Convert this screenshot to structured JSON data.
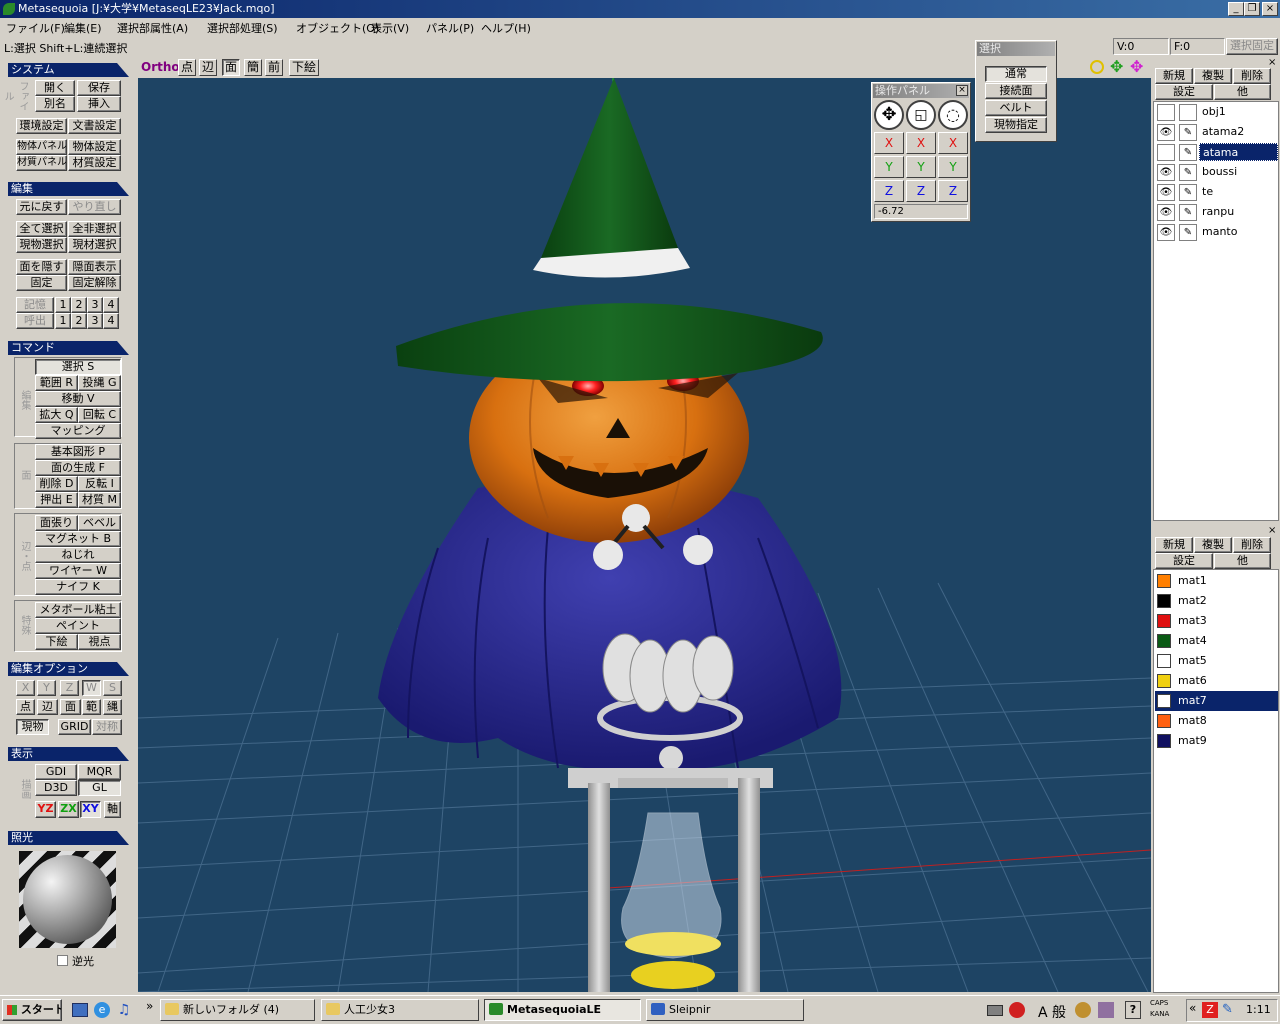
{
  "window": {
    "title": "Metasequoia [J:¥大学¥MetaseqLE23¥Jack.mqo]"
  },
  "menus": [
    "ファイル(F)",
    "編集(E)",
    "選択部属性(A)",
    "選択部処理(S)",
    "オブジェクト(O)",
    "表示(V)",
    "パネル(P)",
    "ヘルプ(H)"
  ],
  "status": {
    "hint": "L:選択  Shift+L:連続選択",
    "v": "V:0",
    "f": "F:0",
    "lock": "選択固定"
  },
  "sections": {
    "system": "システム",
    "edit": "編集",
    "command": "コマンド",
    "edit_option": "編集オプション",
    "display": "表示",
    "lighting": "照光"
  },
  "vlabels": {
    "file": "ファイル",
    "edit": "編集",
    "face": "面",
    "edge": "辺・点",
    "special": "特殊",
    "render": "描画"
  },
  "system": {
    "open": "開く",
    "save": "保存",
    "rename": "別名",
    "insert": "挿入",
    "env": "環境設定",
    "doc": "文書設定",
    "objpanel": "物体パネル",
    "objsettings": "物体設定",
    "matpanel": "材質パネル",
    "matsettings": "材質設定"
  },
  "edit": {
    "undo": "元に戻す",
    "redo": "やり直し",
    "selall": "全て選択",
    "deselall": "全非選択",
    "cursel": "現物選択",
    "curmat": "現材選択",
    "hide": "面を隠す",
    "show": "隠面表示",
    "fix": "固定",
    "unfix": "固定解除",
    "memo": "記憶",
    "recall": "呼出",
    "nums": [
      "1",
      "2",
      "3",
      "4"
    ]
  },
  "command": {
    "select": "選択 S",
    "range": "範囲 R",
    "lasso": "投縄 G",
    "move": "移動 V",
    "scale": "拡大 Q",
    "rotate": "回転 C",
    "mapping": "マッピング",
    "basic": "基本図形 P",
    "face": "面の生成 F",
    "delete": "削除 D",
    "flip": "反転 I",
    "extrude": "押出 E",
    "material": "材質 M",
    "facefill": "面張り",
    "bevel": "ベベル",
    "magnet": "マグネット B",
    "twist": "ねじれ",
    "wire": "ワイヤー W",
    "knife": "ナイフ K",
    "metaball": "メタボール粘土",
    "paint": "ペイント",
    "draft": "下絵",
    "viewpoint": "視点"
  },
  "options": {
    "x": "X",
    "y": "Y",
    "z": "Z",
    "w": "W",
    "s": "S",
    "point": "点",
    "edge": "辺",
    "face": "面",
    "range": "範",
    "lasso": "縄",
    "current": "現物",
    "grid": "GRID",
    "sym": "対称"
  },
  "display": {
    "gdi": "GDI",
    "mqr": "MQR",
    "d3d": "D3D",
    "gl": "GL",
    "yz": "YZ",
    "zx": "ZX",
    "xy": "XY",
    "axis": "軸"
  },
  "lighting": {
    "backlight": "逆光"
  },
  "viewtools": {
    "ortho": "Ortho",
    "point": "点",
    "edge": "辺",
    "face": "面",
    "simple": "簡",
    "front": "前",
    "draft": "下絵"
  },
  "selpanel": {
    "title": "選択",
    "normal": "通常",
    "connected": "接続面",
    "belt": "ベルト",
    "curobj": "現物指定"
  },
  "oppanel": {
    "title": "操作パネル",
    "x": "X",
    "y": "Y",
    "z": "Z",
    "value": "-6.72"
  },
  "objpanel": {
    "new": "新規",
    "dup": "複製",
    "del": "削除",
    "settings": "設定",
    "other": "他",
    "objects": [
      {
        "name": "obj1",
        "eye": false
      },
      {
        "name": "atama2",
        "eye": true
      },
      {
        "name": "atama",
        "eye": false,
        "selected": true
      },
      {
        "name": "boussi",
        "eye": true
      },
      {
        "name": "te",
        "eye": true
      },
      {
        "name": "ranpu",
        "eye": true
      },
      {
        "name": "manto",
        "eye": true
      }
    ]
  },
  "matpanel": {
    "new": "新規",
    "dup": "複製",
    "del": "削除",
    "settings": "設定",
    "other": "他",
    "materials": [
      {
        "name": "mat1",
        "color": "#ff7f00"
      },
      {
        "name": "mat2",
        "color": "#000000"
      },
      {
        "name": "mat3",
        "color": "#e01010"
      },
      {
        "name": "mat4",
        "color": "#0a5a14"
      },
      {
        "name": "mat5",
        "color": "#ffffff"
      },
      {
        "name": "mat6",
        "color": "#f0d010"
      },
      {
        "name": "mat7",
        "color": "#ffffff",
        "selected": true
      },
      {
        "name": "mat8",
        "color": "#ff6010"
      },
      {
        "name": "mat9",
        "color": "#101060"
      }
    ]
  },
  "taskbar": {
    "start": "スタート",
    "tasks": [
      {
        "label": "新しいフォルダ (4)"
      },
      {
        "label": "人工少女3"
      },
      {
        "label": "MetasequoiaLE",
        "active": true
      },
      {
        "label": "Sleipnir"
      }
    ],
    "ime": "A 般",
    "caps": "CAPS",
    "kana": "KANA",
    "time": "1:11"
  }
}
